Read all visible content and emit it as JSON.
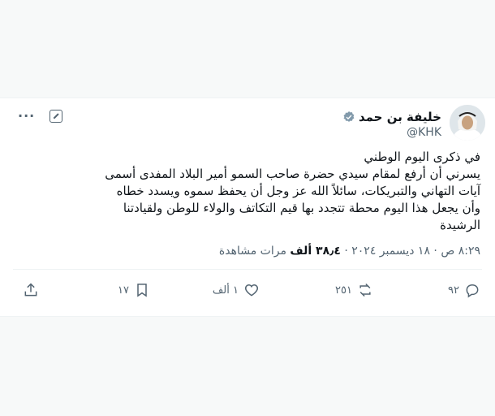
{
  "tweet": {
    "author_name": "خليفة بن حمد",
    "handle": "@KHK",
    "lines": [
      "في ذكرى اليوم الوطني",
      "يسرني أن أرفع لمقام سيدي حضرة صاحب السمو أمير البلاد المفدى أسمى آيات التهاني والتبريكات، سائلاً الله عز وجل أن يحفظ سموه ويسدد خطاه وأن يجعل هذا اليوم محطة تتجدد بها قيم التكاتف والولاء للوطن ولقيادتنا الرشيدة"
    ],
    "time": "٨:٢٩ ص",
    "date": "١٨ ديسمبر ٢٠٢٤",
    "views_count": "٣٨٫٤ ألف",
    "views_label": "مرات مشاهدة",
    "separator": "·"
  },
  "actions": {
    "replies": "٩٢",
    "reposts": "٢٥١",
    "likes": "١ ألف",
    "bookmarks": "١٧"
  },
  "icons": [
    "verified-icon",
    "grok-icon",
    "more-icon",
    "reply-icon",
    "repost-icon",
    "like-icon",
    "bookmark-icon",
    "share-icon"
  ],
  "colors": {
    "text": "#0f1419",
    "muted": "#536471",
    "verified": "#829aab"
  }
}
